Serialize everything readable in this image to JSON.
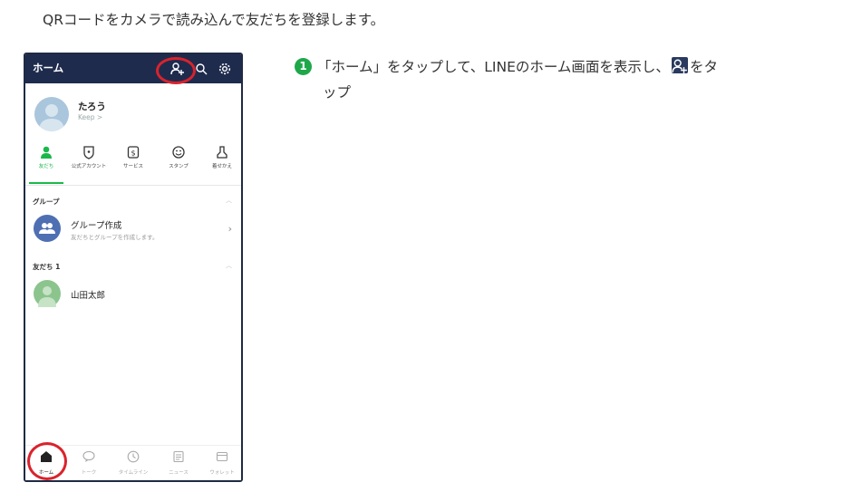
{
  "intro": "QRコードをカメラで読み込んで友だちを登録します。",
  "phone": {
    "header_title": "ホーム",
    "profile": {
      "name": "たろう",
      "sub": "Keep >"
    },
    "tabs": [
      {
        "label": "友だち",
        "icon": "person-icon"
      },
      {
        "label": "公式アカウント",
        "icon": "shield-icon"
      },
      {
        "label": "サービス",
        "icon": "service-icon"
      },
      {
        "label": "スタンプ",
        "icon": "smile-icon"
      },
      {
        "label": "着せかえ",
        "icon": "brush-icon"
      }
    ],
    "groups_header": "グループ",
    "group_row": {
      "title": "グループ作成",
      "sub": "友だちとグループを作成します。"
    },
    "friends_header": "友だち 1",
    "friend_row": {
      "name": "山田太郎"
    },
    "bottom_tabs": [
      {
        "label": "ホーム",
        "icon": "home-icon"
      },
      {
        "label": "トーク",
        "icon": "chat-icon"
      },
      {
        "label": "タイムライン",
        "icon": "clock-icon"
      },
      {
        "label": "ニュース",
        "icon": "news-icon"
      },
      {
        "label": "ウォレット",
        "icon": "wallet-icon"
      }
    ],
    "accent": "#1ab84a",
    "header_bg": "#1f2b4d",
    "highlight": "#d9232d"
  },
  "step": {
    "number": "1",
    "text_a": "「ホーム」をタップして、LINEのホーム画面を表示し、",
    "text_b": "をタ",
    "text_c": "ップ"
  }
}
